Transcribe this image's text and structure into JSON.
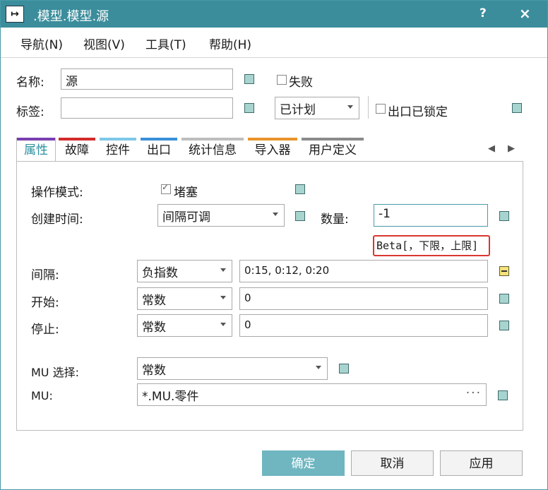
{
  "window": {
    "title": ".模型.模型.源",
    "help": "?",
    "close": "×",
    "app_icon": "↦"
  },
  "menu": [
    "导航(N)",
    "视图(V)",
    "工具(T)",
    "帮助(H)"
  ],
  "header": {
    "name_label": "名称:",
    "name_value": "源",
    "tag_label": "标签:",
    "tag_value": "",
    "failed_label": "失败",
    "plan_value": "已计划",
    "exit_locked_label": "出口已锁定"
  },
  "tabs": [
    {
      "label": "属性",
      "color": "#7a3fb0",
      "active": true
    },
    {
      "label": "故障",
      "color": "#d42a2a"
    },
    {
      "label": "控件",
      "color": "#7dc8e8"
    },
    {
      "label": "出口",
      "color": "#3a8fd8"
    },
    {
      "label": "统计信息",
      "color": "#bdbdbd"
    },
    {
      "label": "导入器",
      "color": "#e8942a"
    },
    {
      "label": "用户定义",
      "color": "#8a8a8a"
    }
  ],
  "props": {
    "mode_label": "操作模式:",
    "blocking_label": "堵塞",
    "create_time_label": "创建时间:",
    "create_time_value": "间隔可调",
    "quantity_label": "数量:",
    "quantity_value": "-1",
    "tooltip": "Beta[，下限，上限]",
    "interval_label": "间隔:",
    "interval_dist": "负指数",
    "interval_value": "0:15, 0:12, 0:20",
    "start_label": "开始:",
    "start_dist": "常数",
    "start_value": "0",
    "stop_label": "停止:",
    "stop_dist": "常数",
    "stop_value": "0",
    "mu_select_label": "MU 选择:",
    "mu_select_value": "常数",
    "mu_label": "MU:",
    "mu_value": "*.MU.零件",
    "mu_dots": "···"
  },
  "buttons": {
    "ok": "确定",
    "cancel": "取消",
    "apply": "应用"
  }
}
